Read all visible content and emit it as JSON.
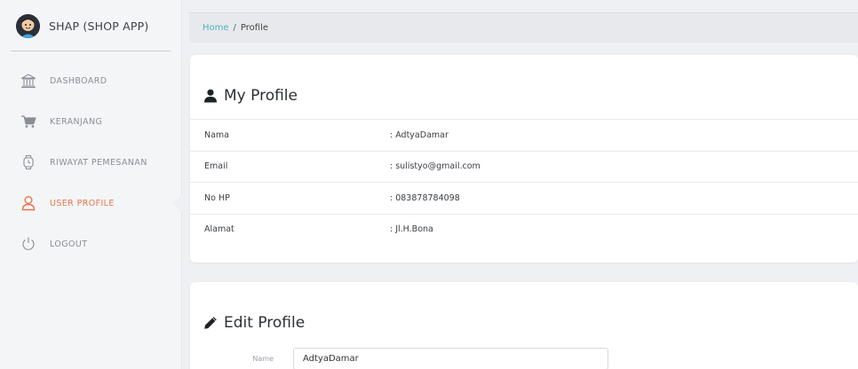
{
  "brand": {
    "title": "SHAP (SHOP APP)"
  },
  "sidebar": {
    "items": [
      {
        "label": "DASHBOARD",
        "icon": "bank-icon"
      },
      {
        "label": "KERANJANG",
        "icon": "cart-icon"
      },
      {
        "label": "RIWAYAT PEMESANAN",
        "icon": "watch-icon"
      },
      {
        "label": "USER PROFILE",
        "icon": "user-icon",
        "active": true
      },
      {
        "label": "LOGOUT",
        "icon": "power-icon"
      }
    ]
  },
  "breadcrumb": {
    "home": "Home",
    "separator": "/",
    "current": "Profile"
  },
  "profile": {
    "title": "My Profile",
    "rows": [
      {
        "key": "Nama",
        "value": ": AdtyaDamar"
      },
      {
        "key": "Email",
        "value": ": sulistyo@gmail.com"
      },
      {
        "key": "No HP",
        "value": ": 083878784098"
      },
      {
        "key": "Alamat",
        "value": ": Jl.H.Bona"
      }
    ]
  },
  "edit": {
    "title": "Edit Profile",
    "name_label": "Name",
    "name_value": "AdtyaDamar"
  },
  "colors": {
    "accent": "#e8754a",
    "link": "#4fb1c7",
    "muted": "#8a8f96"
  }
}
